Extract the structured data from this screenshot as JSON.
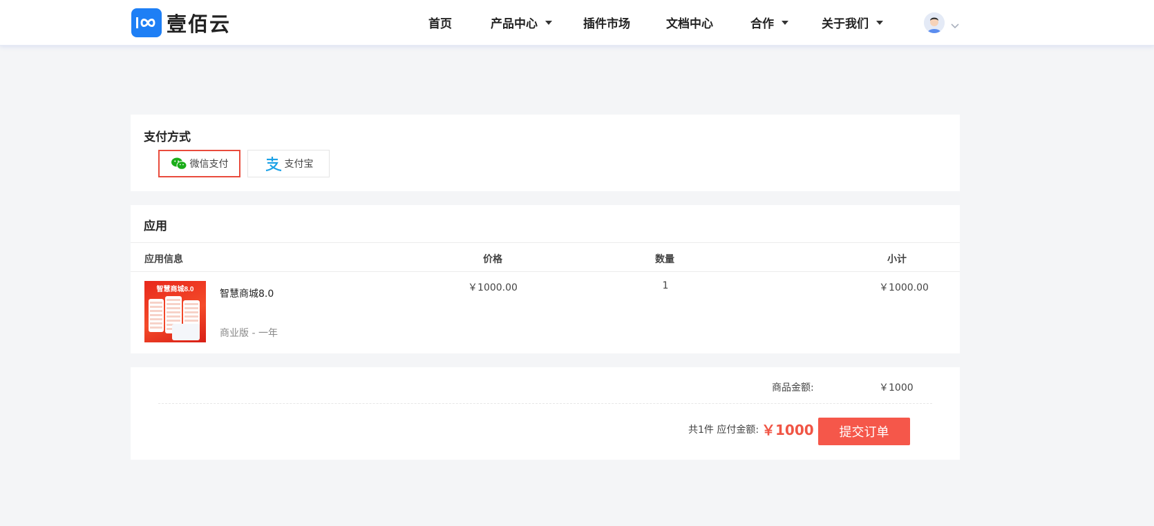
{
  "brand": {
    "name": "壹佰云",
    "accent": "#1e7ff5"
  },
  "nav": {
    "items": [
      {
        "label": "首页",
        "has_dropdown": false
      },
      {
        "label": "产品中心",
        "has_dropdown": true
      },
      {
        "label": "插件市场",
        "has_dropdown": false
      },
      {
        "label": "文档中心",
        "has_dropdown": false
      },
      {
        "label": "合作",
        "has_dropdown": true
      },
      {
        "label": "关于我们",
        "has_dropdown": true
      }
    ],
    "user": {
      "avatar_icon": "user-avatar-icon",
      "menu_icon": "chevron-down-icon"
    }
  },
  "payment": {
    "title": "支付方式",
    "options": [
      {
        "label": "微信支付",
        "icon": "wechat-pay-icon",
        "selected": true,
        "color": "#1aad19"
      },
      {
        "label": "支付宝",
        "icon": "alipay-icon",
        "selected": false,
        "color": "#1ba1e6"
      }
    ],
    "selected_border_color": "#e94b3c"
  },
  "app": {
    "title": "应用",
    "columns": [
      "应用信息",
      "价格",
      "数量",
      "小计"
    ],
    "rows": [
      {
        "image_title": "智慧商城8.0",
        "name": "智慧商城8.0",
        "spec": "商业版 - 一年",
        "price": "￥1000.00",
        "quantity": "1",
        "subtotal": "￥1000.00"
      }
    ]
  },
  "totals": {
    "goods_label": "商品金额:",
    "goods_value": "￥1000",
    "count_text": "共1件 应付金额:",
    "payable": "￥1000",
    "submit_label": "提交订单",
    "accent": "#f5574a"
  }
}
